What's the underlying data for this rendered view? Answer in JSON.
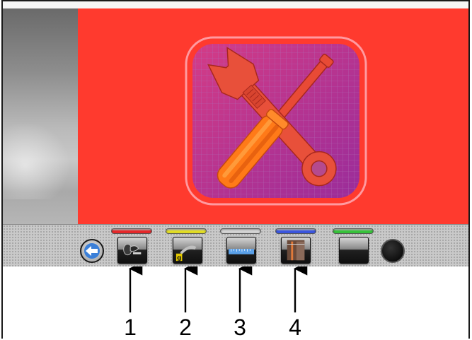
{
  "toolbar": {
    "tab_colors": [
      "#e8282a",
      "#e3de25",
      "#d4d4d4",
      "#3b57e0",
      "#37c43a"
    ],
    "buttons": [
      {
        "icon": "clamp-icon"
      },
      {
        "icon": "weight-icon",
        "badge": "g"
      },
      {
        "icon": "ruler-icon"
      },
      {
        "icon": "wheel-measure-icon"
      },
      {
        "icon": "blank-icon"
      }
    ]
  },
  "callouts": [
    "1",
    "2",
    "3",
    "4"
  ],
  "main": {
    "icon": "tools-wrench-screwdriver-icon",
    "background": "#ff3a2e"
  }
}
